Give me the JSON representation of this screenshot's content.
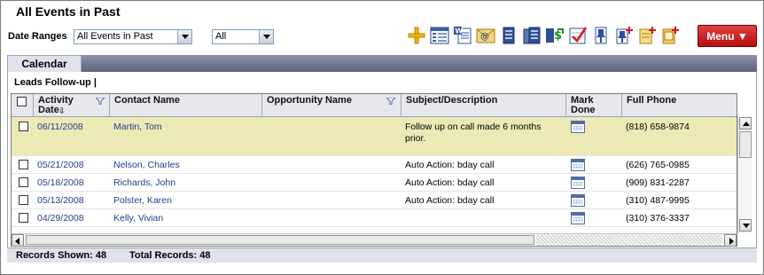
{
  "header": {
    "title": "All Events in Past"
  },
  "filters": {
    "date_ranges_label": "Date Ranges",
    "date_range_value": "All Events in Past",
    "scope_value": "All"
  },
  "toolbar": {
    "icons": [
      "add-icon",
      "list-view-icon",
      "word-doc-icon",
      "email-icon",
      "record-icon",
      "record-stack-icon",
      "transfer-icon",
      "checklist-icon",
      "pin-icon",
      "pin-add-icon",
      "note-add-icon",
      "note-add-alt-icon"
    ],
    "menu_label": "Menu ▼"
  },
  "tabs": {
    "calendar_label": "Calendar"
  },
  "section": {
    "title": "Leads Follow-up  |"
  },
  "grid": {
    "columns": {
      "activity_date": "Activity Date",
      "contact_name": "Contact Name",
      "opportunity_name": "Opportunity Name",
      "subject": "Subject/Description",
      "mark_done": "Mark Done",
      "full_phone": "Full Phone"
    },
    "rows": [
      {
        "date": "06/11/2008",
        "contact": "Martin, Tom",
        "opportunity": "",
        "subject": "Follow up on call made 6 months prior.",
        "phone": "(818) 658-9874"
      },
      {
        "date": "05/21/2008",
        "contact": "Nelson, Charles",
        "opportunity": "",
        "subject": "Auto Action: bday call",
        "phone": "(626) 765-0985"
      },
      {
        "date": "05/18/2008",
        "contact": "Richards, John",
        "opportunity": "",
        "subject": "Auto Action: bday call",
        "phone": "(909) 831-2287"
      },
      {
        "date": "05/13/2008",
        "contact": "Polster, Karen",
        "opportunity": "",
        "subject": "Auto Action: bday call",
        "phone": "(310) 487-9995"
      },
      {
        "date": "04/29/2008",
        "contact": "Kelly, Vivian",
        "opportunity": "",
        "subject": "",
        "phone": "(310) 376-3337"
      }
    ]
  },
  "footer": {
    "records_shown": "Records Shown: 48",
    "total_records": "Total Records: 48"
  },
  "colors": {
    "menu_red": "#c41e1e",
    "link_blue": "#1f3f8f",
    "highlight_row": "#ece9b5"
  }
}
